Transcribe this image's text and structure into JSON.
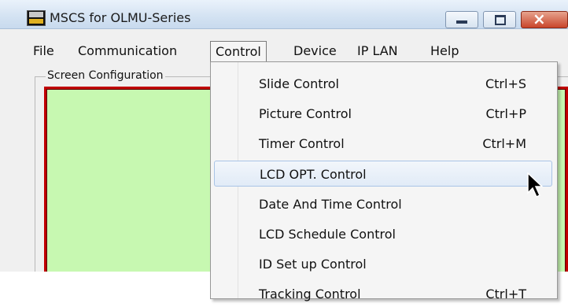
{
  "window": {
    "title": "MSCS for OLMU-Series",
    "icon": "app-icon",
    "controls": [
      "minimize-icon",
      "maximize-icon",
      "close-icon"
    ]
  },
  "menubar": {
    "items": [
      {
        "label": "File"
      },
      {
        "label": "Communication"
      },
      {
        "label": "Control",
        "open": true
      },
      {
        "label": "Device"
      },
      {
        "label": "IP LAN"
      },
      {
        "label": "Help"
      }
    ]
  },
  "panel": {
    "group_label": "Screen Configuration"
  },
  "dropdown": {
    "items": [
      {
        "label": "Slide Control",
        "shortcut": "Ctrl+S"
      },
      {
        "label": "Picture Control",
        "shortcut": "Ctrl+P"
      },
      {
        "label": "Timer Control",
        "shortcut": "Ctrl+M"
      },
      {
        "label": "LCD OPT. Control",
        "shortcut": "",
        "highlighted": true
      },
      {
        "label": "Date And Time Control",
        "shortcut": ""
      },
      {
        "label": "LCD Schedule Control",
        "shortcut": ""
      },
      {
        "label": "ID Set up Control",
        "shortcut": ""
      },
      {
        "label": "Tracking Control",
        "shortcut": "Ctrl+T"
      }
    ]
  },
  "colors": {
    "screen_fill": "#c7f8b1",
    "screen_border": "#c00000",
    "highlight": "#e1ebf7"
  }
}
